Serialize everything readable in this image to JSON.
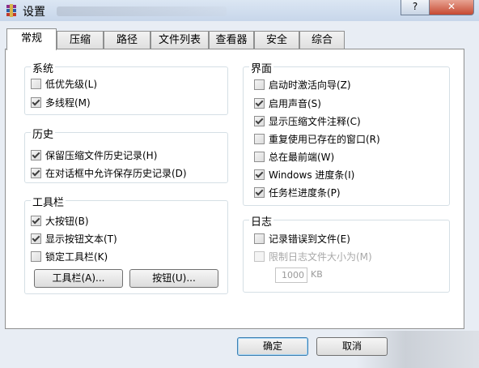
{
  "window": {
    "title": "设置",
    "help_label": "?",
    "close_label": "✕"
  },
  "tabs": [
    "常规",
    "压缩",
    "路径",
    "文件列表",
    "查看器",
    "安全",
    "综合"
  ],
  "groups": {
    "system": {
      "title": "系统",
      "items": [
        {
          "label": "低优先级(L)",
          "checked": false
        },
        {
          "label": "多线程(M)",
          "checked": true
        }
      ]
    },
    "history": {
      "title": "历史",
      "items": [
        {
          "label": "保留压缩文件历史记录(H)",
          "checked": true
        },
        {
          "label": "在对话框中允许保存历史记录(D)",
          "checked": true
        }
      ]
    },
    "toolbar": {
      "title": "工具栏",
      "items": [
        {
          "label": "大按钮(B)",
          "checked": true
        },
        {
          "label": "显示按钮文本(T)",
          "checked": true
        },
        {
          "label": "锁定工具栏(K)",
          "checked": false
        }
      ],
      "toolbar_button": "工具栏(A)...",
      "buttons_button": "按钮(U)..."
    },
    "interface": {
      "title": "界面",
      "items": [
        {
          "label": "启动时激活向导(Z)",
          "checked": false
        },
        {
          "label": "启用声音(S)",
          "checked": true
        },
        {
          "label": "显示压缩文件注释(C)",
          "checked": true
        },
        {
          "label": "重复使用已存在的窗口(R)",
          "checked": false
        },
        {
          "label": "总在最前端(W)",
          "checked": false
        },
        {
          "label": "Windows 进度条(I)",
          "checked": true
        },
        {
          "label": "任务栏进度条(P)",
          "checked": true
        }
      ]
    },
    "log": {
      "title": "日志",
      "items": [
        {
          "label": "记录错误到文件(E)",
          "checked": false
        },
        {
          "label": "限制日志文件大小为(M)",
          "checked": false,
          "disabled": true
        }
      ],
      "size_value": "1000",
      "size_unit": "KB"
    }
  },
  "footer": {
    "ok_label": "确定",
    "cancel_label": "取消"
  }
}
